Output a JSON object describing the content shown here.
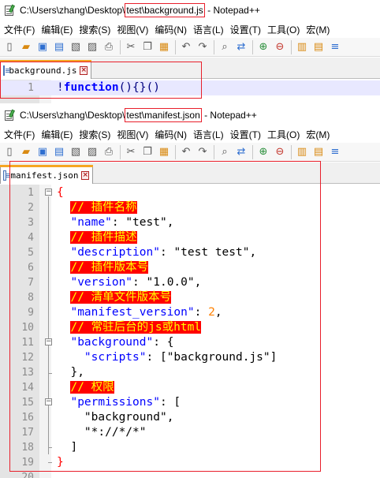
{
  "windows": [
    {
      "title": {
        "path_prefix": "C:\\Users\\zhang\\Desktop\\",
        "path_highlight": "test\\background.js",
        "app": " - Notepad++"
      },
      "tab": {
        "label": "background.js"
      },
      "lines": [
        {
          "num": "1",
          "tokens": [
            {
              "t": "!",
              "c": "op"
            },
            {
              "t": "function",
              "c": "kw"
            },
            {
              "t": "(){}()",
              "c": "op"
            }
          ]
        }
      ]
    },
    {
      "title": {
        "path_prefix": "C:\\Users\\zhang\\Desktop\\",
        "path_highlight": "test\\manifest.json",
        "app": " - Notepad++"
      },
      "tab": {
        "label": "manifest.json"
      },
      "lines": [
        {
          "num": "1",
          "tokens": [
            {
              "t": "{",
              "c": "brace-red"
            }
          ]
        },
        {
          "num": "2",
          "tokens": [
            {
              "t": "  ",
              "c": "plain"
            },
            {
              "t": "// 插件名称",
              "c": "cmt"
            }
          ]
        },
        {
          "num": "3",
          "tokens": [
            {
              "t": "  ",
              "c": "plain"
            },
            {
              "t": "\"name\"",
              "c": "key"
            },
            {
              "t": ": ",
              "c": "plain"
            },
            {
              "t": "\"test\"",
              "c": "plain"
            },
            {
              "t": ",",
              "c": "plain"
            }
          ]
        },
        {
          "num": "4",
          "tokens": [
            {
              "t": "  ",
              "c": "plain"
            },
            {
              "t": "// 插件描述",
              "c": "cmt"
            }
          ]
        },
        {
          "num": "5",
          "tokens": [
            {
              "t": "  ",
              "c": "plain"
            },
            {
              "t": "\"description\"",
              "c": "key"
            },
            {
              "t": ": ",
              "c": "plain"
            },
            {
              "t": "\"test test\"",
              "c": "plain"
            },
            {
              "t": ",",
              "c": "plain"
            }
          ]
        },
        {
          "num": "6",
          "tokens": [
            {
              "t": "  ",
              "c": "plain"
            },
            {
              "t": "// 插件版本号",
              "c": "cmt"
            }
          ]
        },
        {
          "num": "7",
          "tokens": [
            {
              "t": "  ",
              "c": "plain"
            },
            {
              "t": "\"version\"",
              "c": "key"
            },
            {
              "t": ": ",
              "c": "plain"
            },
            {
              "t": "\"1.0.0\"",
              "c": "plain"
            },
            {
              "t": ",",
              "c": "plain"
            }
          ]
        },
        {
          "num": "8",
          "tokens": [
            {
              "t": "  ",
              "c": "plain"
            },
            {
              "t": "// 清单文件版本号",
              "c": "cmt"
            }
          ]
        },
        {
          "num": "9",
          "tokens": [
            {
              "t": "  ",
              "c": "plain"
            },
            {
              "t": "\"manifest_version\"",
              "c": "key"
            },
            {
              "t": ": ",
              "c": "plain"
            },
            {
              "t": "2",
              "c": "num"
            },
            {
              "t": ",",
              "c": "plain"
            }
          ]
        },
        {
          "num": "10",
          "tokens": [
            {
              "t": "  ",
              "c": "plain"
            },
            {
              "t": "// 常驻后台的js或html",
              "c": "cmt"
            }
          ]
        },
        {
          "num": "11",
          "tokens": [
            {
              "t": "  ",
              "c": "plain"
            },
            {
              "t": "\"background\"",
              "c": "key"
            },
            {
              "t": ": {",
              "c": "plain"
            }
          ]
        },
        {
          "num": "12",
          "tokens": [
            {
              "t": "    ",
              "c": "plain"
            },
            {
              "t": "\"scripts\"",
              "c": "key"
            },
            {
              "t": ": [\"background.js\"]",
              "c": "plain"
            }
          ]
        },
        {
          "num": "13",
          "tokens": [
            {
              "t": "  },",
              "c": "plain"
            }
          ]
        },
        {
          "num": "14",
          "tokens": [
            {
              "t": "  ",
              "c": "plain"
            },
            {
              "t": "// 权限",
              "c": "cmt"
            }
          ]
        },
        {
          "num": "15",
          "tokens": [
            {
              "t": "  ",
              "c": "plain"
            },
            {
              "t": "\"permissions\"",
              "c": "key"
            },
            {
              "t": ": [",
              "c": "plain"
            }
          ]
        },
        {
          "num": "16",
          "tokens": [
            {
              "t": "    ",
              "c": "plain"
            },
            {
              "t": "\"background\"",
              "c": "plain"
            },
            {
              "t": ",",
              "c": "plain"
            }
          ]
        },
        {
          "num": "17",
          "tokens": [
            {
              "t": "    ",
              "c": "plain"
            },
            {
              "t": "\"*://*/*\"",
              "c": "plain"
            }
          ]
        },
        {
          "num": "18",
          "tokens": [
            {
              "t": "  ]",
              "c": "plain"
            }
          ]
        },
        {
          "num": "19",
          "tokens": [
            {
              "t": "}",
              "c": "brace-red"
            }
          ]
        },
        {
          "num": "20",
          "tokens": []
        }
      ]
    }
  ],
  "menu": [
    "文件(F)",
    "编辑(E)",
    "搜索(S)",
    "视图(V)",
    "编码(N)",
    "语言(L)",
    "设置(T)",
    "工具(O)",
    "宏(M)"
  ],
  "toolbar_icons": [
    "new-file-icon",
    "open-file-icon",
    "save-icon",
    "save-all-icon",
    "close-icon",
    "close-all-icon",
    "print-icon",
    "cut-icon",
    "copy-icon",
    "paste-icon",
    "undo-icon",
    "redo-icon",
    "find-icon",
    "replace-icon",
    "zoom-in-icon",
    "zoom-out-icon",
    "sync-vertical-icon",
    "sync-horizontal-icon",
    "word-wrap-icon"
  ],
  "colors": {
    "highlight_box": "#e81f2b",
    "comment_bg": "#ff0000",
    "comment_fg": "#ffff00",
    "keyword": "#0000ff",
    "number": "#ff8000",
    "tab_accent": "#f5a623"
  }
}
